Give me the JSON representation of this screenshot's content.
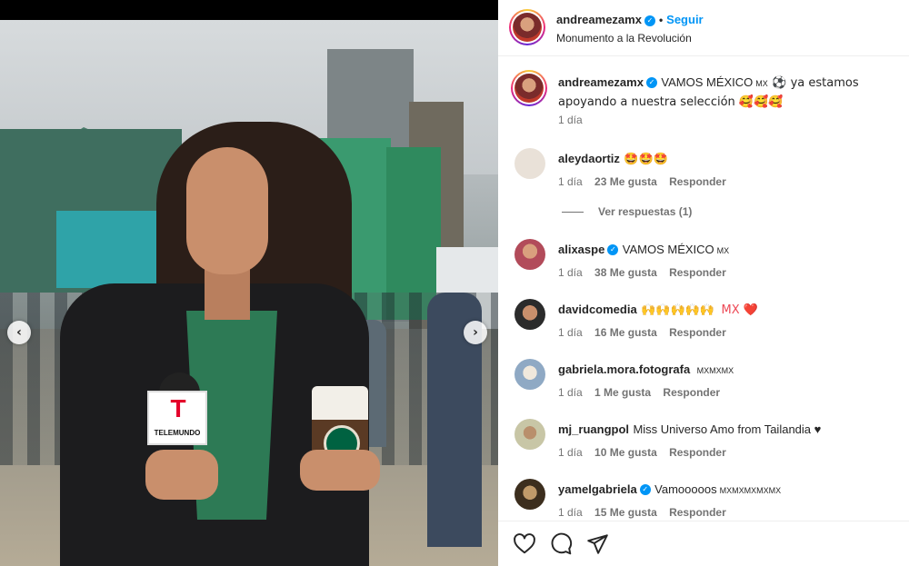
{
  "media": {
    "nav_prev": "‹",
    "nav_next": "›",
    "mic_letter": "T",
    "mic_brand": "TELEMUNDO"
  },
  "header": {
    "username": "andreamezamx",
    "separator": "•",
    "follow_label": "Seguir",
    "location": "Monumento a la Revolución"
  },
  "caption": {
    "username": "andreamezamx",
    "text_before_flag": "VAMOS MÉXICO",
    "flag": "MX",
    "text_after": "⚽ ya estamos apoyando a nuestra selección 🥰🥰🥰",
    "time": "1 día"
  },
  "comments": [
    {
      "username": "aleydaortiz",
      "verified": false,
      "text": "🤩🤩🤩",
      "flags": "",
      "time": "1 día",
      "likes": "23 Me gusta",
      "reply": "Responder",
      "avatar_color": "#e9e1d8"
    },
    {
      "username": "alixaspe",
      "verified": true,
      "text": "VAMOS MÉXICO",
      "flags": "MX",
      "time": "1 día",
      "likes": "38 Me gusta",
      "reply": "Responder",
      "avatar_color": "#b24b5a"
    },
    {
      "username": "davidcomedia",
      "verified": false,
      "text": "🙌🙌🙌🙌🙌",
      "flags": "MX ❤️",
      "time": "1 día",
      "likes": "16 Me gusta",
      "reply": "Responder",
      "avatar_color": "#2b2b2b"
    },
    {
      "username": "gabriela.mora.fotografa",
      "verified": false,
      "text": "",
      "flags": "MXMXMX",
      "time": "1 día",
      "likes": "1 Me gusta",
      "reply": "Responder",
      "avatar_color": "#8fa9c4"
    },
    {
      "username": "mj_ruangpol",
      "verified": false,
      "text": "Miss Universo Amo from Tailandia ♥",
      "flags": "",
      "time": "1 día",
      "likes": "10 Me gusta",
      "reply": "Responder",
      "avatar_color": "#c8c6a6"
    },
    {
      "username": "yamelgabriela",
      "verified": true,
      "text": "Vamooooos",
      "flags": "MXMXMXMXMX",
      "time": "1 día",
      "likes": "15 Me gusta",
      "reply": "Responder",
      "avatar_color": "#3c2e1e"
    }
  ],
  "view_replies": "Ver respuestas (1)",
  "footer": {
    "like_icon": "heart-icon",
    "comment_icon": "comment-icon",
    "share_icon": "share-icon"
  },
  "colors": {
    "accent": "#0095f6",
    "text": "#262626",
    "muted": "#737373",
    "heart": "#ed4956"
  }
}
